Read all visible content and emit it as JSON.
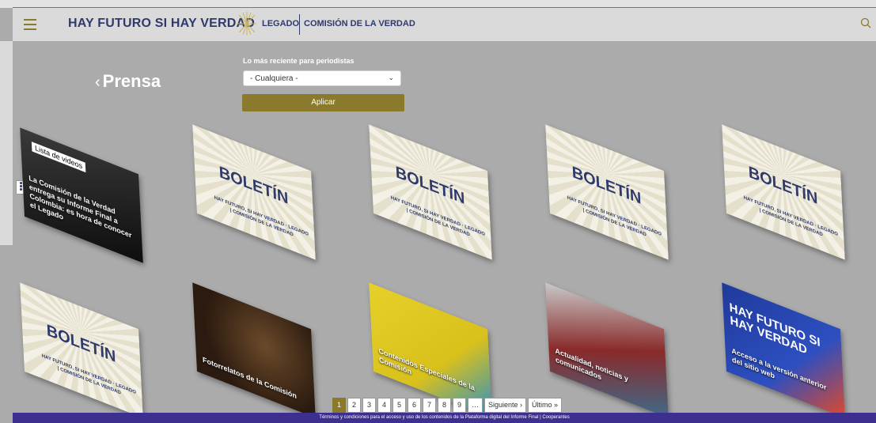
{
  "header": {
    "brand": "HAY FUTURO SI HAY VERDAD",
    "legado": "LEGADO",
    "comision": "COMISIÓN DE LA VERDAD"
  },
  "page": {
    "back_label": "Prensa",
    "filter_label": "Lo más reciente para periodistas",
    "select_value": "- Cualquiera -",
    "apply_label": "Aplicar"
  },
  "cards": [
    {
      "type": "video",
      "tag": "Lista de videos",
      "caption": "La Comisión de la Verdad entrega su Informe Final a Colombia: es hora de conocer el Legado"
    },
    {
      "type": "boletin",
      "title": "BOLETÍN",
      "sub": "HAY FUTURO, SI HAY VERDAD · LEGADO | COMISIÓN DE LA VERDAD"
    },
    {
      "type": "boletin",
      "title": "BOLETÍN",
      "sub": "HAY FUTURO, SI HAY VERDAD · LEGADO | COMISIÓN DE LA VERDAD"
    },
    {
      "type": "boletin",
      "title": "BOLETÍN",
      "sub": "HAY FUTURO, SI HAY VERDAD · LEGADO | COMISIÓN DE LA VERDAD"
    },
    {
      "type": "boletin",
      "title": "BOLETÍN",
      "sub": "HAY FUTURO, SI HAY VERDAD · LEGADO | COMISIÓN DE LA VERDAD"
    },
    {
      "type": "boletin",
      "title": "BOLETÍN",
      "sub": "HAY FUTURO, SI HAY VERDAD · LEGADO | COMISIÓN DE LA VERDAD"
    },
    {
      "type": "photo",
      "caption": "Fotorrelatos de la Comisión"
    },
    {
      "type": "yellow",
      "caption": "Contenidos Especiales de la Comisión"
    },
    {
      "type": "crowd",
      "caption": "Actualidad, noticias y comunicados"
    },
    {
      "type": "blue",
      "title": "HAY FUTURO SI HAY VERDAD",
      "caption": "Acceso a la versión anterior del sitio web"
    }
  ],
  "pager": {
    "pages": [
      "1",
      "2",
      "3",
      "4",
      "5",
      "6",
      "7",
      "8",
      "9",
      "…"
    ],
    "next": "Siguiente ›",
    "last": "Último »"
  },
  "footer": {
    "text": "Términos y condiciones para el acceso y uso de los contenidos de la Plataforma digital del Informe Final | Cooperantes"
  }
}
